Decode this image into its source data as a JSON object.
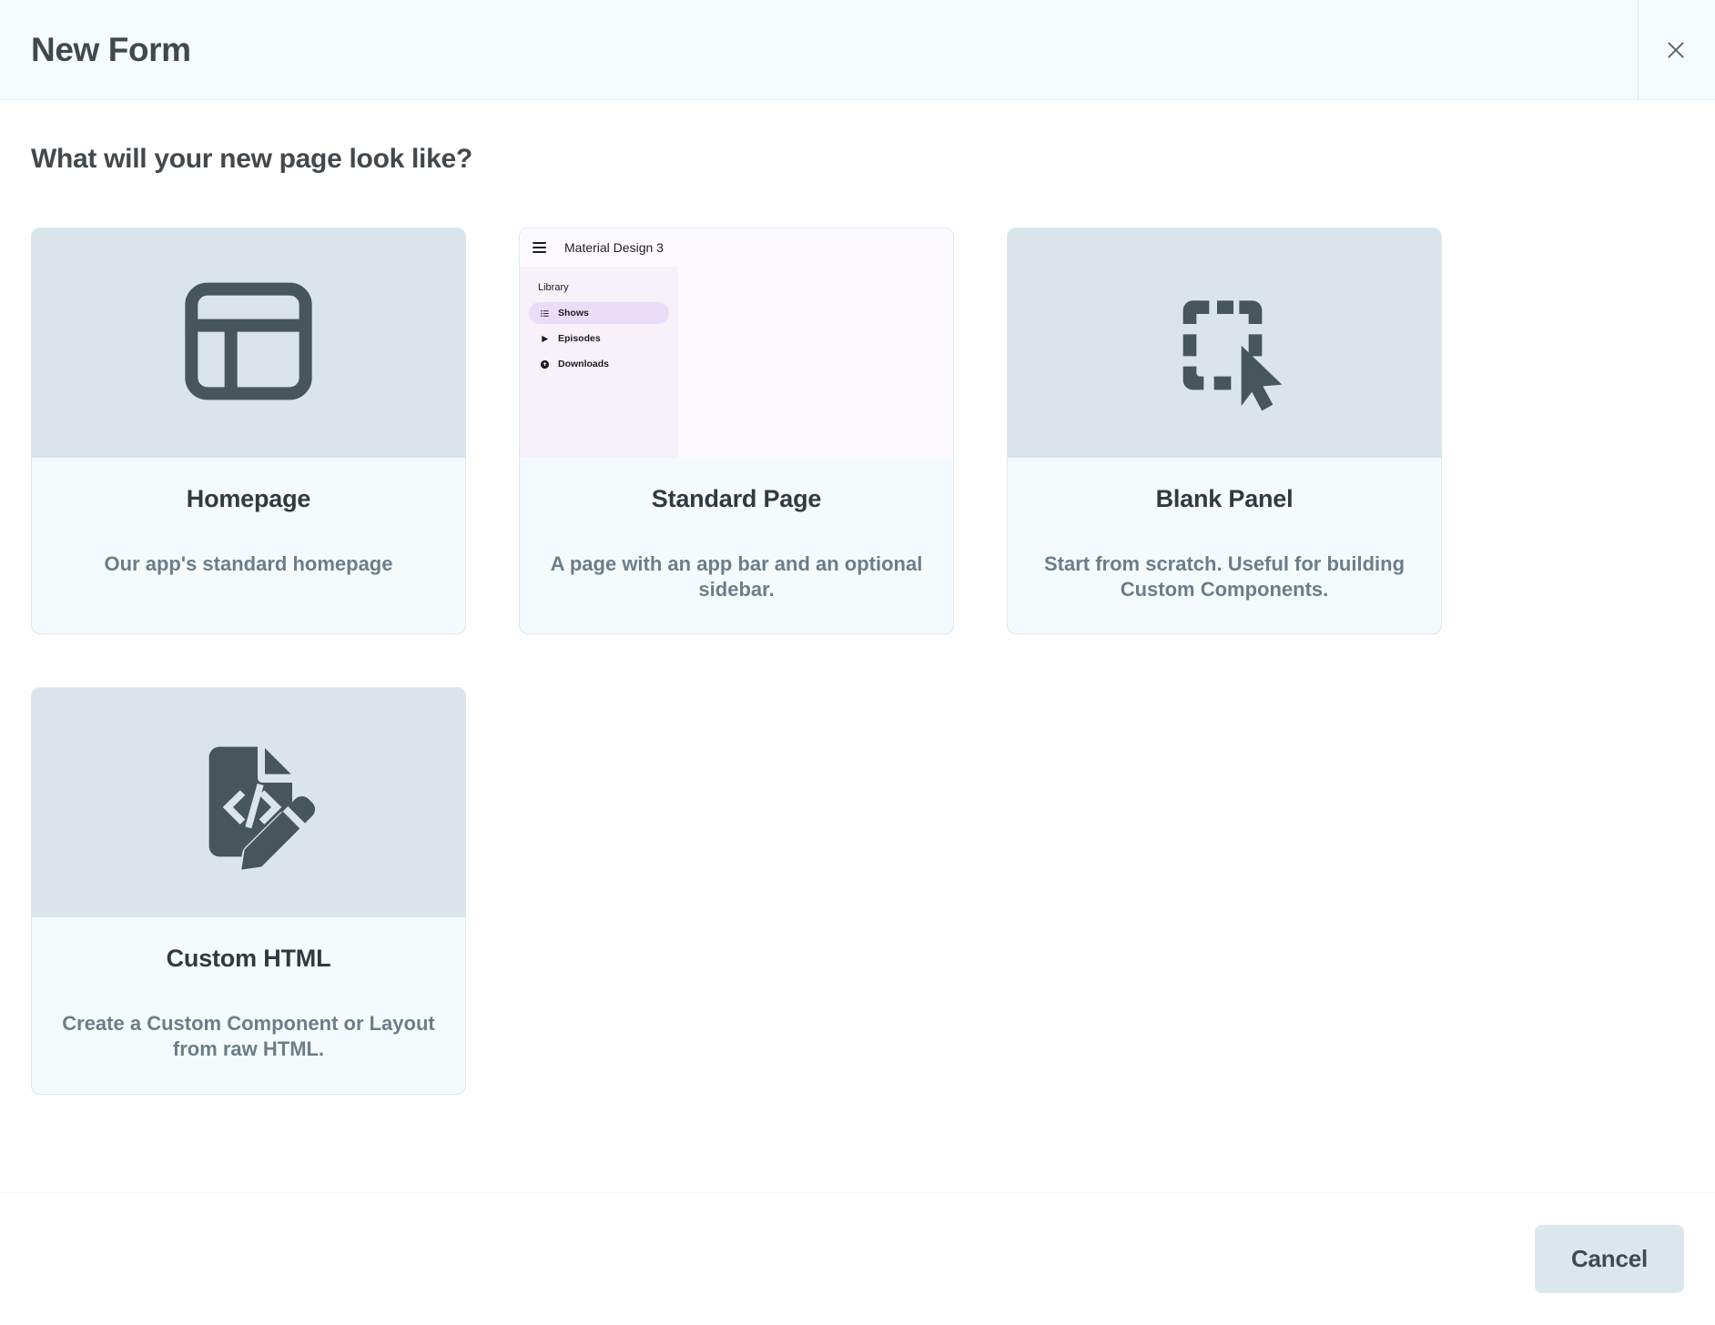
{
  "dialog": {
    "title": "New Form",
    "close_icon": "close-icon",
    "heading": "What will your new page look like?"
  },
  "cards": [
    {
      "id": "homepage",
      "title": "Homepage",
      "description": "Our app's standard homepage",
      "icon": "dashboard-layout-icon",
      "media_type": "icon"
    },
    {
      "id": "standard-page",
      "title": "Standard Page",
      "description": "A page with an app bar and an optional sidebar.",
      "icon": "material-design-preview",
      "media_type": "preview"
    },
    {
      "id": "blank-panel",
      "title": "Blank Panel",
      "description": "Start from scratch. Useful for building Custom Components.",
      "icon": "selection-cursor-icon",
      "media_type": "icon"
    },
    {
      "id": "custom-html",
      "title": "Custom HTML",
      "description": "Create a Custom Component or Layout from raw HTML.",
      "icon": "code-document-pencil-icon",
      "media_type": "icon"
    }
  ],
  "preview": {
    "appbar_title": "Material Design 3",
    "menu_icon": "hamburger-menu-icon",
    "section_label": "Library",
    "nav_items": [
      {
        "label": "Shows",
        "icon": "list-icon",
        "active": true
      },
      {
        "label": "Episodes",
        "icon": "play-icon",
        "active": false
      },
      {
        "label": "Downloads",
        "icon": "download-circle-icon",
        "active": false
      }
    ]
  },
  "footer": {
    "cancel_label": "Cancel"
  },
  "colors": {
    "header_bg": "#f6fbfd",
    "card_media_bg": "#dae4ea",
    "card_body_bg": "#f5fbfd",
    "card_border": "#dde8ee",
    "icon": "#47555c",
    "title_text": "#34393d",
    "desc_text": "#6c7d89",
    "cancel_bg": "#dce7ed",
    "md_sidebar_bg": "#f7f1fa",
    "md_active_pill": "#e9ddf8"
  }
}
